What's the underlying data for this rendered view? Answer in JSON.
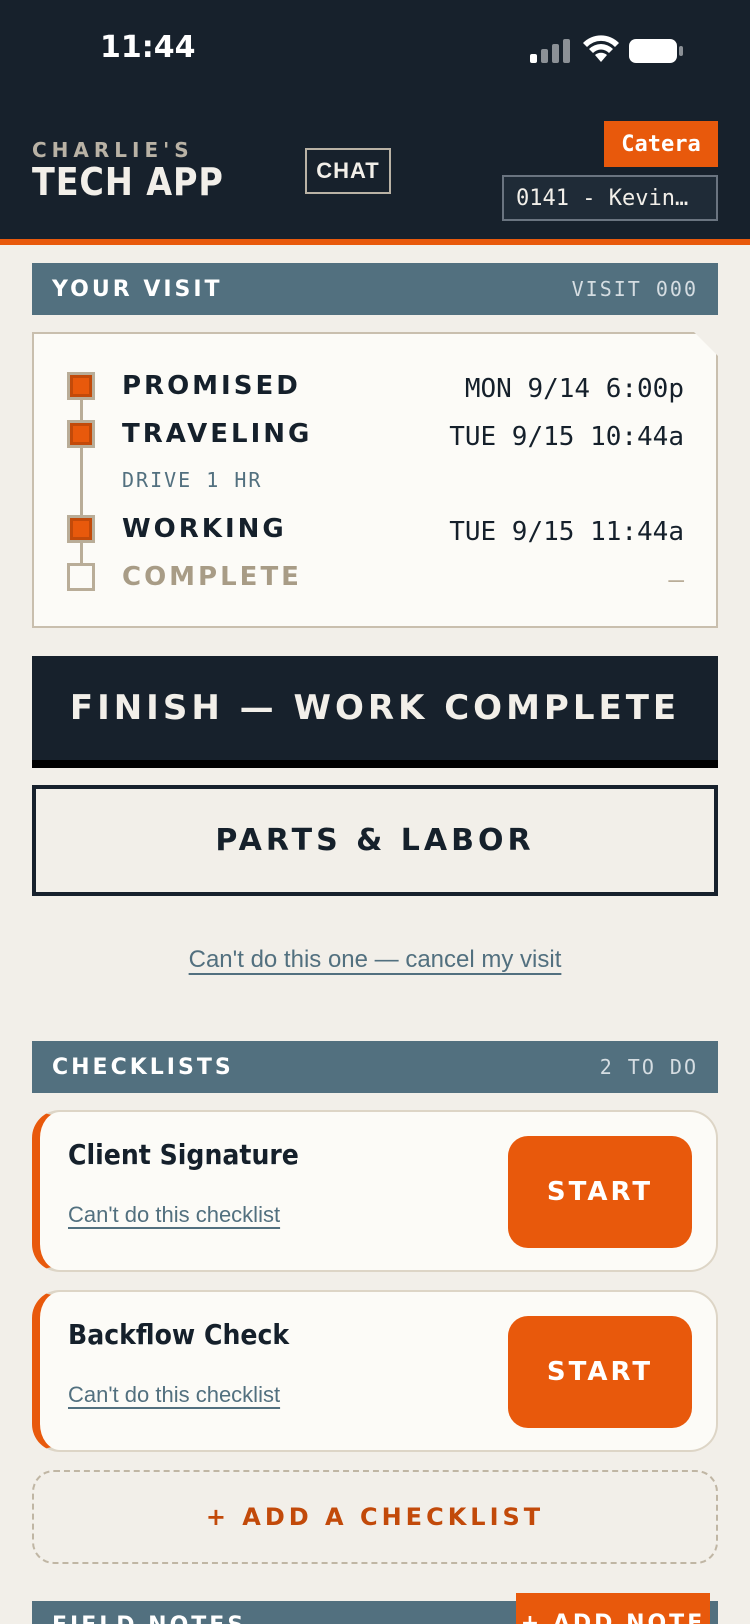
{
  "status_bar": {
    "time": "11:44"
  },
  "header": {
    "brand_small": "CHARLIE'S",
    "brand_big": "TECH APP",
    "chat_label": "CHAT",
    "company": "Catera",
    "job_selector": "0141 - Kevin…"
  },
  "visit": {
    "title": "YOUR VISIT",
    "visit_id": "VISIT 000",
    "timeline": [
      {
        "label": "PROMISED",
        "time": "MON 9/14 6:00p",
        "done": true
      },
      {
        "label": "TRAVELING",
        "time": "TUE 9/15 10:44a",
        "done": true,
        "sub": "DRIVE 1 HR"
      },
      {
        "label": "WORKING",
        "time": "TUE 9/15 11:44a",
        "done": true
      },
      {
        "label": "COMPLETE",
        "time": "—",
        "done": false
      }
    ]
  },
  "actions": {
    "finish_label": "FINISH — WORK COMPLETE",
    "parts_label": "PARTS & LABOR",
    "cancel_label": "Can't do this one — cancel my visit"
  },
  "checklists": {
    "title": "CHECKLISTS",
    "count": "2 TO DO",
    "items": [
      {
        "title": "Client Signature",
        "skip_label": "Can't do this checklist",
        "start_label": "START"
      },
      {
        "title": "Backflow Check",
        "skip_label": "Can't do this checklist",
        "start_label": "START"
      }
    ],
    "add_label": "+ ADD A CHECKLIST"
  },
  "notes": {
    "title": "FIELD NOTES",
    "add_label": "+ ADD NOTE"
  },
  "colors": {
    "navy": "#17212c",
    "accent": "#e8590c",
    "slate": "#52707f",
    "background": "#f2efe9"
  }
}
